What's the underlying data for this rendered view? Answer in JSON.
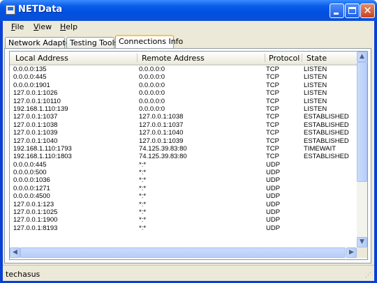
{
  "window": {
    "title": "NETData"
  },
  "menubar": {
    "items": [
      {
        "label": "File",
        "accel": "F",
        "rest": "ile"
      },
      {
        "label": "View",
        "accel": "V",
        "rest": "iew"
      },
      {
        "label": "Help",
        "accel": "H",
        "rest": "elp"
      }
    ]
  },
  "tabs": [
    {
      "label": "Network Adapters",
      "selected": false
    },
    {
      "label": "Testing Tools",
      "selected": false
    },
    {
      "label": "Connections Info",
      "selected": true
    }
  ],
  "table": {
    "columns": [
      "Local Address",
      "Remote Address",
      "Protocol",
      "State"
    ],
    "rows": [
      [
        "0.0.0.0:135",
        "0.0.0.0:0",
        "TCP",
        "LISTEN"
      ],
      [
        "0.0.0.0:445",
        "0.0.0.0:0",
        "TCP",
        "LISTEN"
      ],
      [
        "0.0.0.0:1901",
        "0.0.0.0:0",
        "TCP",
        "LISTEN"
      ],
      [
        "127.0.0.1:1026",
        "0.0.0.0:0",
        "TCP",
        "LISTEN"
      ],
      [
        "127.0.0.1:10110",
        "0.0.0.0:0",
        "TCP",
        "LISTEN"
      ],
      [
        "192.168.1.110:139",
        "0.0.0.0:0",
        "TCP",
        "LISTEN"
      ],
      [
        "127.0.0.1:1037",
        "127.0.0.1:1038",
        "TCP",
        "ESTABLISHED"
      ],
      [
        "127.0.0.1:1038",
        "127.0.0.1:1037",
        "TCP",
        "ESTABLISHED"
      ],
      [
        "127.0.0.1:1039",
        "127.0.0.1:1040",
        "TCP",
        "ESTABLISHED"
      ],
      [
        "127.0.0.1:1040",
        "127.0.0.1:1039",
        "TCP",
        "ESTABLISHED"
      ],
      [
        "192.168.1.110:1793",
        "74.125.39.83:80",
        "TCP",
        "TIMEWAIT"
      ],
      [
        "192.168.1.110:1803",
        "74.125.39.83:80",
        "TCP",
        "ESTABLISHED"
      ],
      [
        "0.0.0.0:445",
        "*:*",
        "UDP",
        ""
      ],
      [
        "0.0.0.0:500",
        "*:*",
        "UDP",
        ""
      ],
      [
        "0.0.0.0:1036",
        "*:*",
        "UDP",
        ""
      ],
      [
        "0.0.0.0:1271",
        "*:*",
        "UDP",
        ""
      ],
      [
        "0.0.0.0:4500",
        "*:*",
        "UDP",
        ""
      ],
      [
        "127.0.0.1:123",
        "*:*",
        "UDP",
        ""
      ],
      [
        "127.0.0.1:1025",
        "*:*",
        "UDP",
        ""
      ],
      [
        "127.0.0.1:1900",
        "*:*",
        "UDP",
        ""
      ],
      [
        "127.0.0.1:8193",
        "*:*",
        "UDP",
        ""
      ]
    ]
  },
  "statusbar": {
    "text": "techasus"
  },
  "icons": {
    "app": "app-icon",
    "minimize": "minimize-icon",
    "maximize": "maximize-icon",
    "close": "close-icon",
    "scroll_up": "chevron-up-icon",
    "scroll_down": "chevron-down-icon",
    "scroll_left": "chevron-left-icon",
    "scroll_right": "chevron-right-icon",
    "grip": "resize-grip-icon"
  },
  "colors": {
    "titlebar": "#0a5bea",
    "close_button": "#c9431f",
    "selected_tab_accent": "#ffc83c"
  }
}
